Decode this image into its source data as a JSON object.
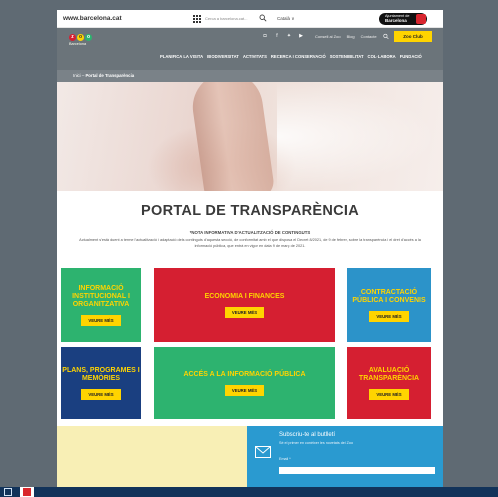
{
  "topbar": {
    "site_url": "www.barcelona.cat",
    "search_placeholder": "Cerca a barcelona.cat...",
    "language": "Català ∨",
    "ajuntament_line1": "Ajuntament de",
    "ajuntament_line2": "Barcelona"
  },
  "header": {
    "logo_letters": [
      "z",
      "o",
      "o"
    ],
    "logo_sub": "Barcelona",
    "util_links": [
      "Consell al Zoo",
      "Blog",
      "Contacte"
    ],
    "zoo_club": "Zoo Club",
    "nav": [
      "PLANIFICA LA VISITA",
      "BIODIVERSITAT",
      "ACTIVITATS",
      "RECERCA I CONSERVACIÓ",
      "SOSTENIBILITAT",
      "COL·LABORA",
      "FUNDACIÓ"
    ]
  },
  "breadcrumb": {
    "home": "Inici",
    "separator": " – ",
    "current": "Portal de Transparència"
  },
  "main": {
    "title": "PORTAL DE TRANSPARÈNCIA",
    "nota_title": "*NOTA INFORMATIVA D'ACTUALITZACIÓ DE CONTINGUTS",
    "nota_body": "Actualment s'està duent a terme l'actualització i adaptació dels continguts d'aquesta secció, de conformitat amb el que disposa el Decret 8/2021, de 9 de febrer, sobre la transparència i el dret d'accés a la informació pública, que entrà en vigor en data 9 de març de 2021."
  },
  "tiles": [
    {
      "title": "INFORMACIÓ INSTITUCIONAL I ORGANITZATIVA",
      "button": "VEURE MÉS",
      "color": "#2db36f"
    },
    {
      "title": "ECONOMIA I FINANCES",
      "button": "VEURE MÉS",
      "color": "#d51f31"
    },
    {
      "title": "CONTRACTACIÓ PÚBLICA I CONVENIS",
      "button": "VEURE MÉS",
      "color": "#2c93c9"
    },
    {
      "title": "PLANS, PROGRAMES I MEMÒRIES",
      "button": "VEURE MÉS",
      "color": "#1a3f80"
    },
    {
      "title": "ACCÉS A LA INFORMACIÓ PÚBLICA",
      "button": "VEURE MÉS",
      "color": "#2db36f"
    },
    {
      "title": "AVALUACIÓ TRANSPARÈNCIA",
      "button": "VEURE MÉS",
      "color": "#d51f31"
    }
  ],
  "footer": {
    "newsletter_title": "Subscriu-te al butlletí",
    "newsletter_sub": "Sé el primer en conèixer les novetats del Zoo",
    "email_label": "Email *"
  },
  "colors": {
    "accent_yellow": "#ffd400",
    "header_gray": "#6b747a",
    "green": "#2db36f",
    "red": "#d51f31",
    "blue": "#2c93c9",
    "navy": "#1a3f80"
  }
}
